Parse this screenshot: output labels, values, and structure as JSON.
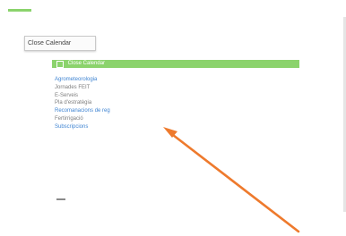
{
  "tooltip": {
    "text": "Close Calendar"
  },
  "green_bar": {
    "label": "Close Calendar"
  },
  "menu": {
    "items": [
      {
        "label": "Agrometeorologia",
        "style": "link"
      },
      {
        "label": "Jornades FEIT",
        "style": "gray"
      },
      {
        "label": "E-Serveis",
        "style": "gray"
      },
      {
        "label": "Pla d'estratègia",
        "style": "gray"
      },
      {
        "label": "Recomanacions de reg",
        "style": "link"
      },
      {
        "label": "Fertirrigació",
        "style": "gray"
      },
      {
        "label": "Subscripcions",
        "style": "link"
      }
    ]
  },
  "colors": {
    "accent_green": "#8bd36c",
    "link_blue": "#3f84d2",
    "arrow_orange": "#ee7a2d"
  }
}
